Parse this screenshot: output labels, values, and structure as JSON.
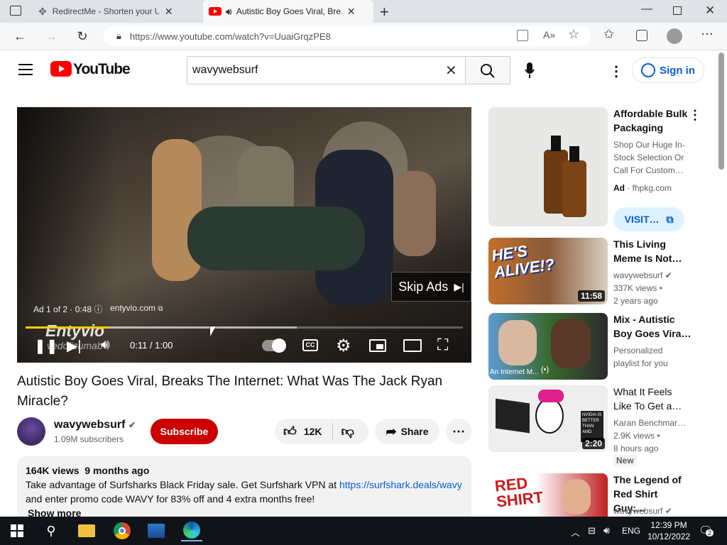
{
  "browser": {
    "tabs": [
      {
        "title": "RedirectMe - Shorten your URL f",
        "active": false
      },
      {
        "title": "Autistic Boy Goes Viral, Brea",
        "active": true
      }
    ],
    "url": "https://www.youtube.com/watch?v=UuaiGrqzPE8"
  },
  "youtube": {
    "logo_text": "YouTube",
    "search_value": "wavywebsurf",
    "sign_in": "Sign in"
  },
  "player": {
    "ad_label": "Ad 1 of 2 · 0:48",
    "ad_site": "entyvio.com",
    "brand": "Entyvio",
    "brand_sub": "vedolizumab",
    "skip": "Skip Ads",
    "time": "0:11 / 1:00",
    "progress": 0.19,
    "buffered": 0.62
  },
  "video": {
    "title": "Autistic Boy Goes Viral, Breaks The Internet: What Was The Jack Ryan Miracle?",
    "channel": "wavywebsurf",
    "subscribers": "1.09M subscribers",
    "subscribe": "Subscribe",
    "likes": "12K",
    "share": "Share",
    "views": "164K views",
    "age": "9 months ago",
    "desc_line1_pre": "Take advantage of Surfsharks Black Friday sale. Get Surfshark VPN at ",
    "desc_link": "https://surfshark.deals/wavy",
    "desc_line2": "and enter promo code WAVY for 83% off and 4 extra months free!",
    "show_more": "Show more"
  },
  "sidebar": {
    "ad": {
      "title": "Affordable Bulk Packaging",
      "desc": "Shop Our Huge In-Stock Selection Or Call For Custom…",
      "ad_badge": "Ad",
      "domain": "fhpkg.com",
      "visit": "VISIT…"
    },
    "items": [
      {
        "title": "This Living Meme Is Not…",
        "channel": "wavywebsurf",
        "meta1": "337K views •",
        "meta2": "2 years ago",
        "duration": "11:58",
        "thumb_text": "HE'S ALIVE!?"
      },
      {
        "title": "Mix - Autistic Boy Goes Vira…",
        "channel": "Personalized",
        "meta1": "playlist for you",
        "meta2": "",
        "duration": "",
        "thumb_text": "An Internet M..."
      },
      {
        "title": "What It Feels Like To Get a…",
        "channel": "Karan Benchmar…",
        "meta1": "2.9K views •",
        "meta2": "8 hours ago",
        "duration": "2:20",
        "badge": "New",
        "thumb_text": "NVIDIA IS BETTER THAN AMD"
      },
      {
        "title": "The Legend of Red Shirt Guy:…",
        "channel": "wavywebsurf",
        "meta1": "",
        "meta2": "",
        "duration": "",
        "thumb_text": "RED SHIRT"
      }
    ]
  },
  "taskbar": {
    "lang": "ENG",
    "time": "12:39 PM",
    "date": "10/12/2022",
    "notif": "2"
  }
}
